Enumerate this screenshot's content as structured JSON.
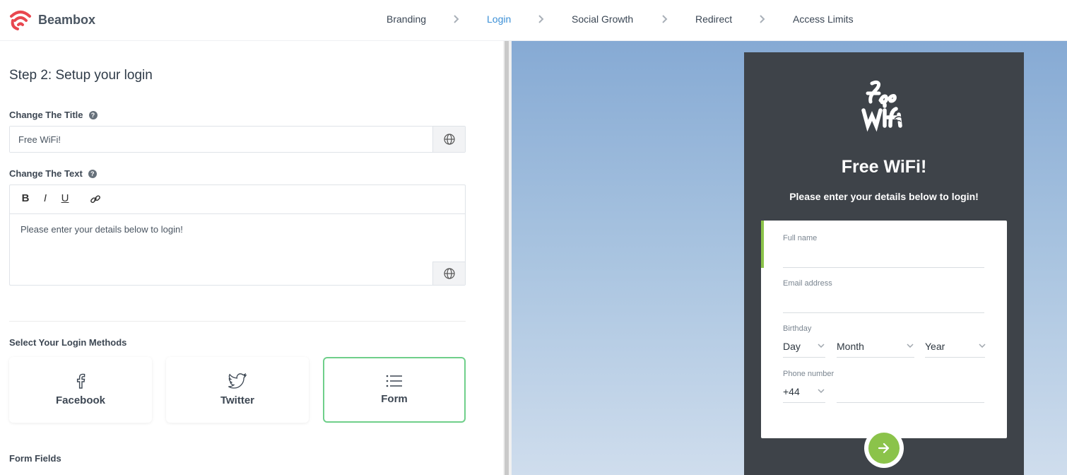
{
  "app": {
    "name": "Beambox"
  },
  "steps": [
    {
      "label": "Branding",
      "active": false
    },
    {
      "label": "Login",
      "active": true
    },
    {
      "label": "Social Growth",
      "active": false
    },
    {
      "label": "Redirect",
      "active": false
    },
    {
      "label": "Access Limits",
      "active": false
    }
  ],
  "editor_panel": {
    "heading": "Step 2: Setup your login",
    "title_label": "Change The Title",
    "title_value": "Free WiFi!",
    "text_label": "Change The Text",
    "toolbar": {
      "bold": "B",
      "italic": "I",
      "underline": "U"
    },
    "text_value": "Please enter your details below to login!",
    "methods_label": "Select Your Login Methods",
    "methods": [
      {
        "label": "Facebook",
        "icon": "facebook-icon",
        "selected": false
      },
      {
        "label": "Twitter",
        "icon": "twitter-icon",
        "selected": false
      },
      {
        "label": "Form",
        "icon": "list-icon",
        "selected": true
      }
    ],
    "form_fields_label": "Form Fields"
  },
  "preview": {
    "title": "Free WiFi!",
    "subtitle": "Please enter your details below to login!",
    "fields": {
      "full_name": "Full name",
      "email": "Email address",
      "birthday": "Birthday",
      "day": "Day",
      "month": "Month",
      "year": "Year",
      "phone": "Phone number",
      "country_code": "+44"
    },
    "colors": {
      "accent": "#8bc34a",
      "card": "#3e4349"
    }
  },
  "colors": {
    "active_step": "#3b8fd6",
    "brand": "#e8474f",
    "selected_border": "#6fcf8a"
  }
}
